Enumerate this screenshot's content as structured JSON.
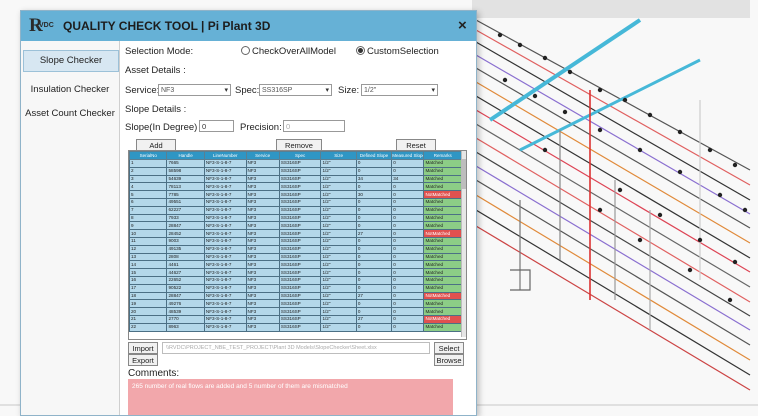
{
  "window": {
    "title": "QUALITY CHECK TOOL | Pi Plant 3D",
    "logo_text": "R",
    "logo_sub": "VDC",
    "close_glyph": "×"
  },
  "sidebar": {
    "items": [
      {
        "label": "Slope Checker",
        "active": true
      },
      {
        "label": "Insulation Checker",
        "active": false
      },
      {
        "label": "Asset Count Checker",
        "active": false
      }
    ]
  },
  "form": {
    "selection_mode_label": "Selection Mode:",
    "radio_all": "CheckOverAllModel",
    "radio_custom": "CustomSelection",
    "radio_selected": "CustomSelection",
    "asset_details_label": "Asset Details :",
    "service_label": "Service:",
    "service_value": "NF3",
    "spec_label": "Spec:",
    "spec_value": "SS316SP",
    "size_label": "Size:",
    "size_value": "1/2\"",
    "slope_details_label": "Slope Details :",
    "slope_label": "Slope(In Degree) :",
    "slope_value": "0",
    "precision_label": "Precision:",
    "precision_value": "0"
  },
  "buttons": {
    "add": "Add",
    "remove": "Remove",
    "reset": "Reset",
    "import": "Import",
    "export": "Export",
    "select": "Select",
    "browse": "Browse"
  },
  "table": {
    "columns": [
      "SerialNo",
      "Handle",
      "LineNumber",
      "Service",
      "Spec",
      "Size",
      "Defined Slope",
      "Measured Slope",
      "Remarks"
    ],
    "rows": [
      [
        "1",
        "7665",
        "NF3-S-1-8-7",
        "NF3",
        "SS316SP",
        "1/2\"",
        "0",
        "0",
        "Matched"
      ],
      [
        "2",
        "58598",
        "NF3-S-1-8-7",
        "NF3",
        "SS316SP",
        "1/2\"",
        "0",
        "0",
        "Matched"
      ],
      [
        "3",
        "54639",
        "NF3-S-1-8-7",
        "NF3",
        "SS316SP",
        "1/2\"",
        "34",
        "34",
        "Matched"
      ],
      [
        "4",
        "78113",
        "NF3-S-1-8-7",
        "NF3",
        "SS316SP",
        "1/2\"",
        "0",
        "0",
        "Matched"
      ],
      [
        "5",
        "7785",
        "NF3-S-1-8-7",
        "NF3",
        "SS316SP",
        "1/2\"",
        "30",
        "0",
        "NotMatched"
      ],
      [
        "6",
        "49551",
        "NF3-S-1-8-7",
        "NF3",
        "SS316SP",
        "1/2\"",
        "0",
        "0",
        "Matched"
      ],
      [
        "7",
        "62227",
        "NF3-S-1-8-7",
        "NF3",
        "SS316SP",
        "1/2\"",
        "0",
        "0",
        "Matched"
      ],
      [
        "8",
        "7933",
        "NF3-S-1-8-7",
        "NF3",
        "SS316SP",
        "1/2\"",
        "0",
        "0",
        "Matched"
      ],
      [
        "9",
        "28847",
        "NF3-S-1-8-7",
        "NF3",
        "SS316SP",
        "1/2\"",
        "0",
        "0",
        "Matched"
      ],
      [
        "10",
        "28452",
        "NF3-S-1-8-7",
        "NF3",
        "SS316SP",
        "1/2\"",
        "27",
        "0",
        "NotMatched"
      ],
      [
        "11",
        "9003",
        "NF3-S-1-8-7",
        "NF3",
        "SS316SP",
        "1/2\"",
        "0",
        "0",
        "Matched"
      ],
      [
        "12",
        "49135",
        "NF3-S-1-8-7",
        "NF3",
        "SS316SP",
        "1/2\"",
        "0",
        "0",
        "Matched"
      ],
      [
        "13",
        "2808",
        "NF3-S-1-8-7",
        "NF3",
        "SS316SP",
        "1/2\"",
        "0",
        "0",
        "Matched"
      ],
      [
        "14",
        "4461",
        "NF3-S-1-8-7",
        "NF3",
        "SS316SP",
        "1/2\"",
        "0",
        "0",
        "Matched"
      ],
      [
        "15",
        "44627",
        "NF3-S-1-8-7",
        "NF3",
        "SS316SP",
        "1/2\"",
        "0",
        "0",
        "Matched"
      ],
      [
        "16",
        "22652",
        "NF3-S-1-8-7",
        "NF3",
        "SS316SP",
        "1/2\"",
        "0",
        "0",
        "Matched"
      ],
      [
        "17",
        "90522",
        "NF3-S-1-8-7",
        "NF3",
        "SS316SP",
        "1/2\"",
        "0",
        "0",
        "Matched"
      ],
      [
        "18",
        "28847",
        "NF3-S-1-8-7",
        "NF3",
        "SS316SP",
        "1/2\"",
        "27",
        "0",
        "NotMatched"
      ],
      [
        "19",
        "49276",
        "NF3-S-1-8-7",
        "NF3",
        "SS316SP",
        "1/2\"",
        "0",
        "0",
        "Matched"
      ],
      [
        "20",
        "48539",
        "NF3-S-1-8-7",
        "NF3",
        "SS316SP",
        "1/2\"",
        "0",
        "0",
        "Matched"
      ],
      [
        "21",
        "2770",
        "NF3-S-1-8-7",
        "NF3",
        "SS316SP",
        "1/2\"",
        "27",
        "0",
        "NotMatched"
      ],
      [
        "22",
        "8963",
        "NF3-S-1-8-7",
        "NF3",
        "SS316SP",
        "1/2\"",
        "0",
        "0",
        "Matched"
      ]
    ]
  },
  "file_path": "\\\\RVDC\\PROJECT_NBE_TEST_PROJECT\\Plant 3D Models\\SlopeChecker\\Sheet.xlsx",
  "comments": {
    "label": "Comments:",
    "text": "265 number of real flows are added and 5 number of them are mismatched"
  },
  "colors": {
    "title_bar": "#66b1d6",
    "header": "#2f96c4",
    "row": "#b4d8ea",
    "matched": "#8ccd86",
    "not_matched": "#e0514f",
    "comments_bg": "#f2a7ab"
  }
}
